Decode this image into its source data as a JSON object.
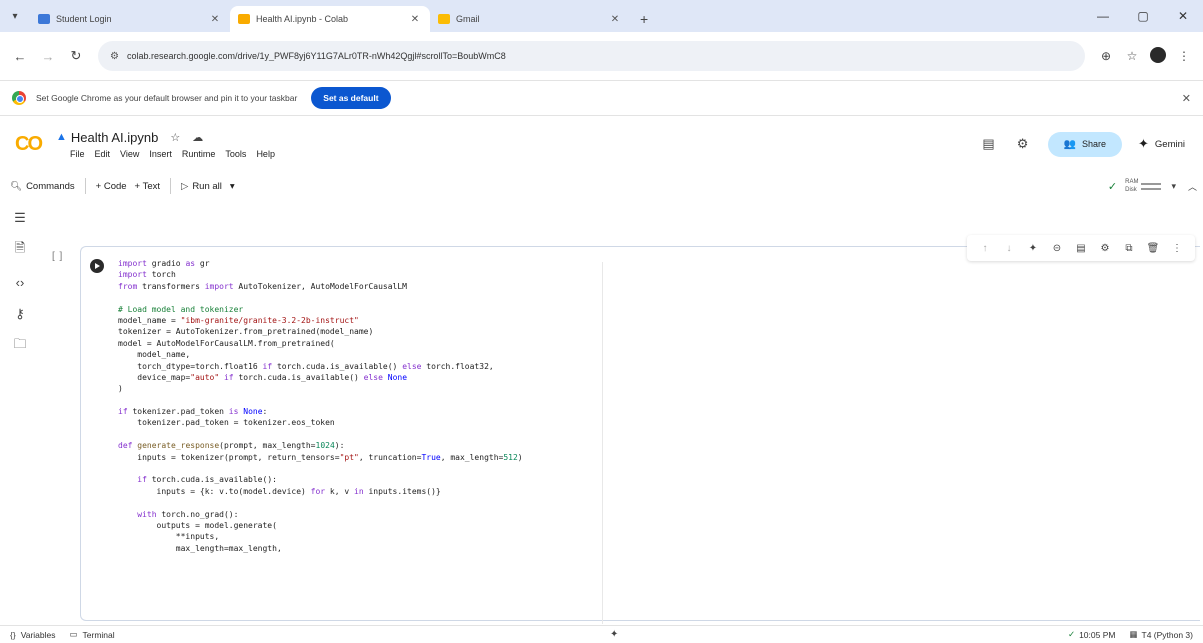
{
  "browser": {
    "tabs": [
      {
        "title": "Student Login",
        "favicon_color": "#3c78d8"
      },
      {
        "title": "Health AI.ipynb - Colab",
        "favicon_color": "#f9ab00"
      },
      {
        "title": "Gmail",
        "favicon_color": "#fbbc05"
      }
    ],
    "url": "colab.research.google.com/drive/1y_PWF8yj6Y11G7ALr0TR-nWh42Qgjl#scrollTo=BoubWmC8",
    "infobar_text": "Set Google Chrome as your default browser and pin it to your taskbar",
    "infobar_button": "Set as default"
  },
  "colab": {
    "logo": "CO",
    "notebook_title": "Health AI.ipynb",
    "menu": [
      "File",
      "Edit",
      "View",
      "Insert",
      "Runtime",
      "Tools",
      "Help"
    ],
    "share_label": "Share",
    "gemini_label": "Gemini",
    "toolbar": {
      "commands": "Commands",
      "code": "+ Code",
      "text": "+ Text",
      "run_all": "Run all"
    },
    "resources": {
      "ram": "RAM",
      "disk": "Disk"
    },
    "cell_bracket": "[ ]"
  },
  "code_lines": [
    [
      {
        "t": "import",
        "c": "kw"
      },
      {
        "t": " gradio "
      },
      {
        "t": "as",
        "c": "kw"
      },
      {
        "t": " gr"
      }
    ],
    [
      {
        "t": "import",
        "c": "kw"
      },
      {
        "t": " torch"
      }
    ],
    [
      {
        "t": "from",
        "c": "kw"
      },
      {
        "t": " transformers "
      },
      {
        "t": "import",
        "c": "kw"
      },
      {
        "t": " AutoTokenizer, AutoModelForCausalLM"
      }
    ],
    [
      {
        "t": ""
      }
    ],
    [
      {
        "t": "# Load model and tokenizer",
        "c": "cm"
      }
    ],
    [
      {
        "t": "model_name = "
      },
      {
        "t": "\"ibm-granite/granite-3.2-2b-instruct\"",
        "c": "st"
      }
    ],
    [
      {
        "t": "tokenizer = AutoTokenizer.from_pretrained(model_name)"
      }
    ],
    [
      {
        "t": "model = AutoModelForCausalLM.from_pretrained("
      }
    ],
    [
      {
        "t": "    model_name,"
      }
    ],
    [
      {
        "t": "    torch_dtype=torch.float16 "
      },
      {
        "t": "if",
        "c": "kw"
      },
      {
        "t": " torch.cuda.is_available() "
      },
      {
        "t": "else",
        "c": "kw"
      },
      {
        "t": " torch.float32,"
      }
    ],
    [
      {
        "t": "    device_map="
      },
      {
        "t": "\"auto\"",
        "c": "st"
      },
      {
        "t": " "
      },
      {
        "t": "if",
        "c": "kw"
      },
      {
        "t": " torch.cuda.is_available() "
      },
      {
        "t": "else",
        "c": "kw"
      },
      {
        "t": " "
      },
      {
        "t": "None",
        "c": "bl"
      }
    ],
    [
      {
        "t": ")"
      }
    ],
    [
      {
        "t": ""
      }
    ],
    [
      {
        "t": "if",
        "c": "kw"
      },
      {
        "t": " tokenizer.pad_token "
      },
      {
        "t": "is",
        "c": "kw"
      },
      {
        "t": " "
      },
      {
        "t": "None",
        "c": "bl"
      },
      {
        "t": ":"
      }
    ],
    [
      {
        "t": "    tokenizer.pad_token = tokenizer.eos_token"
      }
    ],
    [
      {
        "t": ""
      }
    ],
    [
      {
        "t": "def",
        "c": "kw"
      },
      {
        "t": " "
      },
      {
        "t": "generate_response",
        "c": "fn"
      },
      {
        "t": "(prompt, max_length="
      },
      {
        "t": "1024",
        "c": "nm"
      },
      {
        "t": "):"
      }
    ],
    [
      {
        "t": "    inputs = tokenizer(prompt, return_tensors="
      },
      {
        "t": "\"pt\"",
        "c": "st"
      },
      {
        "t": ", truncation="
      },
      {
        "t": "True",
        "c": "bl"
      },
      {
        "t": ", max_length="
      },
      {
        "t": "512",
        "c": "nm"
      },
      {
        "t": ")"
      }
    ],
    [
      {
        "t": ""
      }
    ],
    [
      {
        "t": "    "
      },
      {
        "t": "if",
        "c": "kw"
      },
      {
        "t": " torch.cuda.is_available():"
      }
    ],
    [
      {
        "t": "        inputs = {k: v.to(model.device) "
      },
      {
        "t": "for",
        "c": "kw"
      },
      {
        "t": " k, v "
      },
      {
        "t": "in",
        "c": "kw"
      },
      {
        "t": " inputs.items()}"
      }
    ],
    [
      {
        "t": ""
      }
    ],
    [
      {
        "t": "    "
      },
      {
        "t": "with",
        "c": "kw"
      },
      {
        "t": " torch.no_grad():"
      }
    ],
    [
      {
        "t": "        outputs = model.generate("
      }
    ],
    [
      {
        "t": "            **inputs,"
      }
    ],
    [
      {
        "t": "            max_length=max_length,"
      }
    ]
  ],
  "status": {
    "variables": "Variables",
    "terminal": "Terminal",
    "time": "10:05 PM",
    "runtime": "T4 (Python 3)"
  }
}
